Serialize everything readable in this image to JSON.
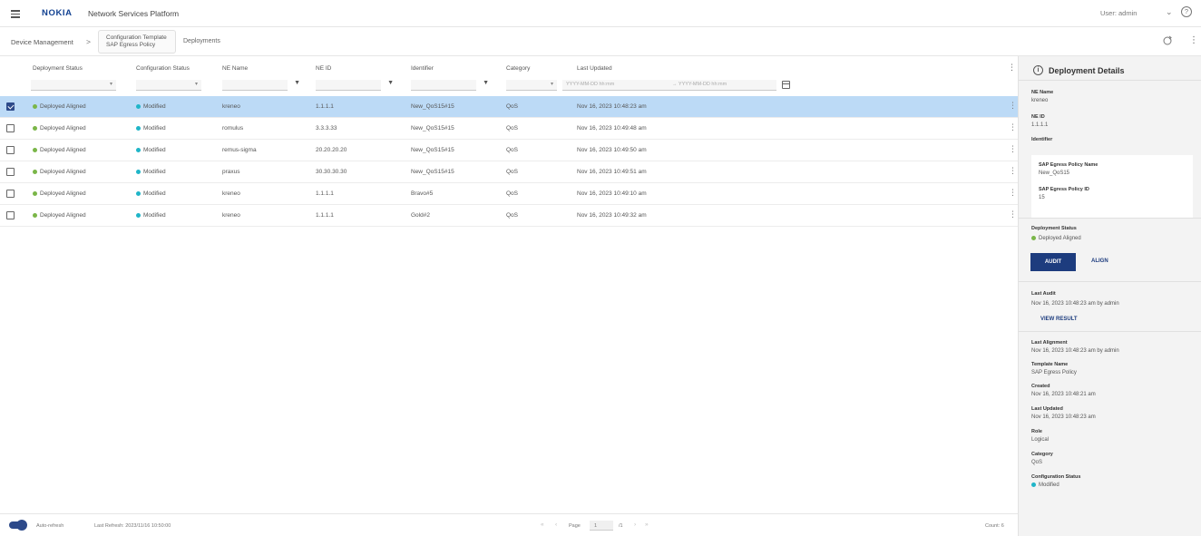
{
  "app": {
    "logo": "NOKIA",
    "title": "Network Services Platform",
    "user": "User: admin",
    "help": "?",
    "menu_caret": "⌄"
  },
  "breadcrumb": {
    "item1": "Device Management",
    "separator": ">",
    "item2_line1": "Configuration Template",
    "item2_line2": "SAP Egress Policy",
    "item3": "Deployments"
  },
  "table": {
    "columns": [
      "Deployment Status",
      "Configuration Status",
      "NE Name",
      "NE ID",
      "Identifier",
      "Category",
      "Last Updated"
    ],
    "date_filter": {
      "from_placeholder": "YYYY-MM-DD hh:mm",
      "to_placeholder": "→ YYYY-MM-DD hh:mm"
    },
    "rows": [
      {
        "selected": true,
        "deployment_status": "Deployed Aligned",
        "config_status": "Modified",
        "ne_name": "kreneo",
        "ne_id": "1.1.1.1",
        "identifier": "New_QoS15#15",
        "category": "QoS",
        "last_updated": "Nov 16, 2023 10:48:23 am"
      },
      {
        "selected": false,
        "deployment_status": "Deployed Aligned",
        "config_status": "Modified",
        "ne_name": "romulus",
        "ne_id": "3.3.3.33",
        "identifier": "New_QoS15#15",
        "category": "QoS",
        "last_updated": "Nov 16, 2023 10:49:48 am"
      },
      {
        "selected": false,
        "deployment_status": "Deployed Aligned",
        "config_status": "Modified",
        "ne_name": "remus-sigma",
        "ne_id": "20.20.20.20",
        "identifier": "New_QoS15#15",
        "category": "QoS",
        "last_updated": "Nov 16, 2023 10:49:50 am"
      },
      {
        "selected": false,
        "deployment_status": "Deployed Aligned",
        "config_status": "Modified",
        "ne_name": "praxus",
        "ne_id": "30.30.30.30",
        "identifier": "New_QoS15#15",
        "category": "QoS",
        "last_updated": "Nov 16, 2023 10:49:51 am"
      },
      {
        "selected": false,
        "deployment_status": "Deployed Aligned",
        "config_status": "Modified",
        "ne_name": "kreneo",
        "ne_id": "1.1.1.1",
        "identifier": "Bravo#5",
        "category": "QoS",
        "last_updated": "Nov 16, 2023 10:49:10 am"
      },
      {
        "selected": false,
        "deployment_status": "Deployed Aligned",
        "config_status": "Modified",
        "ne_name": "kreneo",
        "ne_id": "1.1.1.1",
        "identifier": "Gold#2",
        "category": "QoS",
        "last_updated": "Nov 16, 2023 10:49:32 am"
      }
    ]
  },
  "footer": {
    "auto_refresh": "Auto-refresh",
    "last_refresh": "Last Refresh: 2023/11/16 10:50:00",
    "page_label": "Page",
    "page_number": "1",
    "page_total": "/1",
    "count": "Count: 6"
  },
  "panel": {
    "title": "Deployment Details",
    "ne_name_label": "NE Name",
    "ne_name": "kreneo",
    "ne_id_label": "NE ID",
    "ne_id": "1.1.1.1",
    "identifier_label": "Identifier",
    "sap_name_label": "SAP Egress Policy Name",
    "sap_name": "New_QoS15",
    "sap_id_label": "SAP Egress Policy ID",
    "sap_id": "15",
    "deploy_status_label": "Deployment Status",
    "deploy_status": "Deployed Aligned",
    "audit_btn": "AUDIT",
    "align_btn": "ALIGN",
    "last_audit_label": "Last Audit",
    "last_audit": "Nov 16, 2023 10:48:23 am by admin",
    "view_result_btn": "VIEW RESULT",
    "last_alignment_label": "Last Alignment",
    "last_alignment": "Nov 16, 2023 10:48:23 am by admin",
    "template_name_label": "Template Name",
    "template_name": "SAP Egress Policy",
    "created_label": "Created",
    "created": "Nov 16, 2023 10:48:21 am",
    "last_updated_label": "Last Updated",
    "last_updated": "Nov 16, 2023 10:48:23 am",
    "role_label": "Role",
    "role": "Logical",
    "category_label": "Category",
    "category": "QoS",
    "config_status_label": "Configuration Status",
    "config_status": "Modified"
  },
  "colors": {
    "brand": "#124191",
    "primary_button": "#1d3c7e",
    "selected_row": "#bcdaf6",
    "aligned_dot": "#7ab648",
    "modified_dot": "#20b5c8"
  }
}
